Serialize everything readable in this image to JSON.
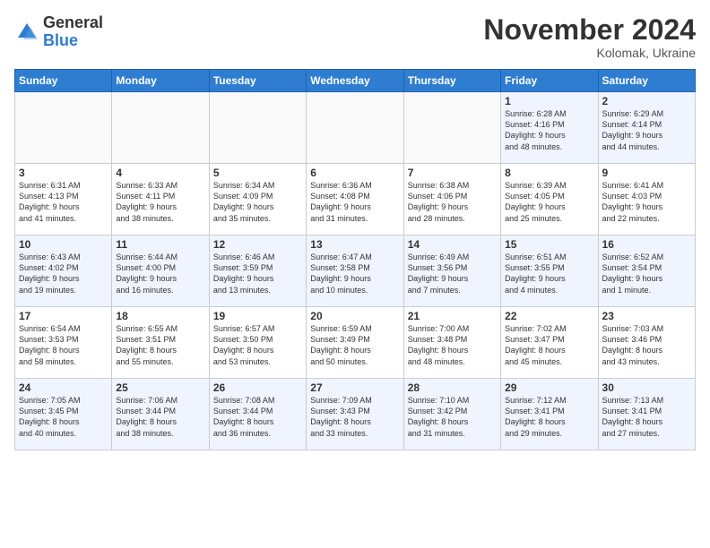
{
  "logo": {
    "general": "General",
    "blue": "Blue"
  },
  "header": {
    "month": "November 2024",
    "location": "Kolomak, Ukraine"
  },
  "days_of_week": [
    "Sunday",
    "Monday",
    "Tuesday",
    "Wednesday",
    "Thursday",
    "Friday",
    "Saturday"
  ],
  "weeks": [
    [
      {
        "day": "",
        "info": ""
      },
      {
        "day": "",
        "info": ""
      },
      {
        "day": "",
        "info": ""
      },
      {
        "day": "",
        "info": ""
      },
      {
        "day": "",
        "info": ""
      },
      {
        "day": "1",
        "info": "Sunrise: 6:28 AM\nSunset: 4:16 PM\nDaylight: 9 hours\nand 48 minutes."
      },
      {
        "day": "2",
        "info": "Sunrise: 6:29 AM\nSunset: 4:14 PM\nDaylight: 9 hours\nand 44 minutes."
      }
    ],
    [
      {
        "day": "3",
        "info": "Sunrise: 6:31 AM\nSunset: 4:13 PM\nDaylight: 9 hours\nand 41 minutes."
      },
      {
        "day": "4",
        "info": "Sunrise: 6:33 AM\nSunset: 4:11 PM\nDaylight: 9 hours\nand 38 minutes."
      },
      {
        "day": "5",
        "info": "Sunrise: 6:34 AM\nSunset: 4:09 PM\nDaylight: 9 hours\nand 35 minutes."
      },
      {
        "day": "6",
        "info": "Sunrise: 6:36 AM\nSunset: 4:08 PM\nDaylight: 9 hours\nand 31 minutes."
      },
      {
        "day": "7",
        "info": "Sunrise: 6:38 AM\nSunset: 4:06 PM\nDaylight: 9 hours\nand 28 minutes."
      },
      {
        "day": "8",
        "info": "Sunrise: 6:39 AM\nSunset: 4:05 PM\nDaylight: 9 hours\nand 25 minutes."
      },
      {
        "day": "9",
        "info": "Sunrise: 6:41 AM\nSunset: 4:03 PM\nDaylight: 9 hours\nand 22 minutes."
      }
    ],
    [
      {
        "day": "10",
        "info": "Sunrise: 6:43 AM\nSunset: 4:02 PM\nDaylight: 9 hours\nand 19 minutes."
      },
      {
        "day": "11",
        "info": "Sunrise: 6:44 AM\nSunset: 4:00 PM\nDaylight: 9 hours\nand 16 minutes."
      },
      {
        "day": "12",
        "info": "Sunrise: 6:46 AM\nSunset: 3:59 PM\nDaylight: 9 hours\nand 13 minutes."
      },
      {
        "day": "13",
        "info": "Sunrise: 6:47 AM\nSunset: 3:58 PM\nDaylight: 9 hours\nand 10 minutes."
      },
      {
        "day": "14",
        "info": "Sunrise: 6:49 AM\nSunset: 3:56 PM\nDaylight: 9 hours\nand 7 minutes."
      },
      {
        "day": "15",
        "info": "Sunrise: 6:51 AM\nSunset: 3:55 PM\nDaylight: 9 hours\nand 4 minutes."
      },
      {
        "day": "16",
        "info": "Sunrise: 6:52 AM\nSunset: 3:54 PM\nDaylight: 9 hours\nand 1 minute."
      }
    ],
    [
      {
        "day": "17",
        "info": "Sunrise: 6:54 AM\nSunset: 3:53 PM\nDaylight: 8 hours\nand 58 minutes."
      },
      {
        "day": "18",
        "info": "Sunrise: 6:55 AM\nSunset: 3:51 PM\nDaylight: 8 hours\nand 55 minutes."
      },
      {
        "day": "19",
        "info": "Sunrise: 6:57 AM\nSunset: 3:50 PM\nDaylight: 8 hours\nand 53 minutes."
      },
      {
        "day": "20",
        "info": "Sunrise: 6:59 AM\nSunset: 3:49 PM\nDaylight: 8 hours\nand 50 minutes."
      },
      {
        "day": "21",
        "info": "Sunrise: 7:00 AM\nSunset: 3:48 PM\nDaylight: 8 hours\nand 48 minutes."
      },
      {
        "day": "22",
        "info": "Sunrise: 7:02 AM\nSunset: 3:47 PM\nDaylight: 8 hours\nand 45 minutes."
      },
      {
        "day": "23",
        "info": "Sunrise: 7:03 AM\nSunset: 3:46 PM\nDaylight: 8 hours\nand 43 minutes."
      }
    ],
    [
      {
        "day": "24",
        "info": "Sunrise: 7:05 AM\nSunset: 3:45 PM\nDaylight: 8 hours\nand 40 minutes."
      },
      {
        "day": "25",
        "info": "Sunrise: 7:06 AM\nSunset: 3:44 PM\nDaylight: 8 hours\nand 38 minutes."
      },
      {
        "day": "26",
        "info": "Sunrise: 7:08 AM\nSunset: 3:44 PM\nDaylight: 8 hours\nand 36 minutes."
      },
      {
        "day": "27",
        "info": "Sunrise: 7:09 AM\nSunset: 3:43 PM\nDaylight: 8 hours\nand 33 minutes."
      },
      {
        "day": "28",
        "info": "Sunrise: 7:10 AM\nSunset: 3:42 PM\nDaylight: 8 hours\nand 31 minutes."
      },
      {
        "day": "29",
        "info": "Sunrise: 7:12 AM\nSunset: 3:41 PM\nDaylight: 8 hours\nand 29 minutes."
      },
      {
        "day": "30",
        "info": "Sunrise: 7:13 AM\nSunset: 3:41 PM\nDaylight: 8 hours\nand 27 minutes."
      }
    ]
  ]
}
